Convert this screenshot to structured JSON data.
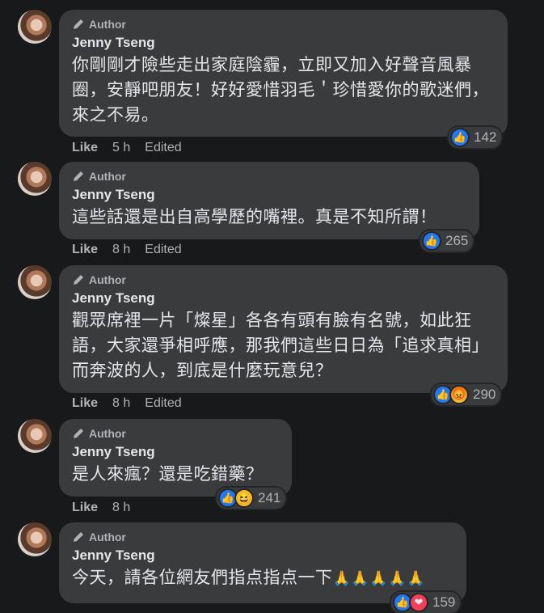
{
  "comments": [
    {
      "author_tag": "Author",
      "name": "Jenny Tseng",
      "text": "你剛剛才險些走出家庭陰霾，立即又加入好聲音風暴圈，安靜吧朋友！好好愛惜羽毛＇珍惜愛你的歌迷們，來之不易。",
      "reaction_count": "142",
      "like_label": "Like",
      "time": "5 h",
      "edited": "Edited"
    },
    {
      "author_tag": "Author",
      "name": "Jenny Tseng",
      "text": "這些話還是出自高學歷的嘴裡。真是不知所謂！",
      "reaction_count": "265",
      "like_label": "Like",
      "time": "8 h",
      "edited": "Edited"
    },
    {
      "author_tag": "Author",
      "name": "Jenny Tseng",
      "text": "觀眾席裡一片「燦星」各各有頭有臉有名號，如此狂語，大家還爭相呼應，那我們這些日日為「追求真相」而奔波的人，到底是什麼玩意兒？",
      "reaction_count": "290",
      "like_label": "Like",
      "time": "8 h",
      "edited": "Edited"
    },
    {
      "author_tag": "Author",
      "name": "Jenny Tseng",
      "text": "是人來瘋？還是吃錯藥？",
      "reaction_count": "241",
      "like_label": "Like",
      "time": "8 h"
    },
    {
      "author_tag": "Author",
      "name": "Jenny Tseng",
      "text": "今天，請各位網友們指点指点一下",
      "emoji": "🙏🙏🙏🙏🙏",
      "reaction_count": "159"
    }
  ],
  "colors": {
    "background": "#18191a",
    "bubble": "#3a3b3c",
    "like_blue": "#2078f4",
    "muted": "#b0b3b8"
  },
  "icons": {
    "author": "pen-icon",
    "like": "thumbs-up-icon",
    "angry": "angry-face-icon",
    "laugh": "laughing-face-icon",
    "love": "heart-icon"
  }
}
